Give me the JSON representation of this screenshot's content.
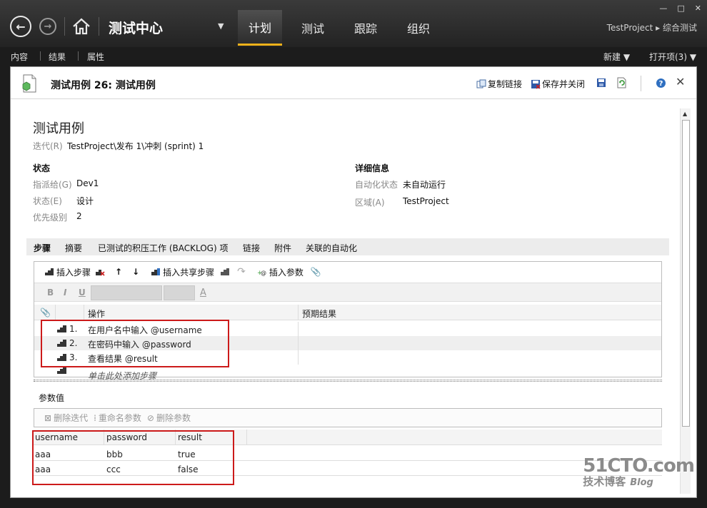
{
  "nav": {
    "app_title": "测试中心",
    "dropdown_glyph": "▼",
    "tabs": [
      {
        "label": "计划",
        "active": true
      },
      {
        "label": "测试",
        "active": false
      },
      {
        "label": "跟踪",
        "active": false
      },
      {
        "label": "组织",
        "active": false
      }
    ],
    "breadcrumb": "TestProject ▸ 综合测试",
    "window_controls": {
      "minimize": "—",
      "maximize": "□",
      "close": "✕"
    }
  },
  "subbar": {
    "left_items": [
      "内容",
      "结果",
      "属性"
    ],
    "new_label": "新建 ▼",
    "open_items_label": "打开项(3) ▼"
  },
  "doc": {
    "title": "测试用例 26: 测试用例",
    "actions": {
      "copy_link": "复制链接",
      "save_close": "保存并关闭"
    },
    "section_title": "测试用例",
    "iteration": {
      "label": "迭代(R)",
      "value": "TestProject\\发布 1\\冲刺 (sprint) 1"
    },
    "status": {
      "header": "状态",
      "assigned": {
        "label": "指派给(G)",
        "value": "Dev1"
      },
      "state": {
        "label": "状态(E)",
        "value": "设计"
      },
      "priority": {
        "label": "优先级别",
        "value": "2"
      }
    },
    "details": {
      "header": "详细信息",
      "automation": {
        "label": "自动化状态",
        "value": "未自动运行"
      },
      "area": {
        "label": "区域(A)",
        "value": "TestProject"
      }
    },
    "tabs": [
      "步骤",
      "摘要",
      "已测试的积压工作 (BACKLOG) 项",
      "链接",
      "附件",
      "关联的自动化"
    ],
    "steps_toolbar": {
      "insert_step": "插入步骤",
      "insert_shared": "插入共享步骤",
      "insert_param": "插入参数"
    },
    "format": {
      "bold": "B",
      "italic": "I",
      "underline": "U",
      "font_color": "A"
    },
    "grid": {
      "col_action": "操作",
      "col_expected": "预期结果",
      "steps": [
        {
          "num": "1.",
          "action": "在用户名中输入 @username",
          "expected": ""
        },
        {
          "num": "2.",
          "action": "在密码中输入 @password",
          "expected": ""
        },
        {
          "num": "3.",
          "action": "查看结果 @result",
          "expected": ""
        }
      ],
      "add_step": "单击此处添加步骤"
    },
    "params": {
      "title": "参数值",
      "toolbar": {
        "delete_iter": "删除迭代",
        "rename": "重命名参数",
        "delete_param": "删除参数"
      },
      "columns": [
        "username",
        "password",
        "result"
      ],
      "rows": [
        [
          "aaa",
          "bbb",
          "true"
        ],
        [
          "aaa",
          "ccc",
          "false"
        ]
      ]
    }
  },
  "watermark": {
    "site": "51CTO.com",
    "sub": "技术博客",
    "blog": "Blog"
  },
  "colors": {
    "accent": "#f0b21a",
    "highlight_box": "#cc1a1a"
  }
}
